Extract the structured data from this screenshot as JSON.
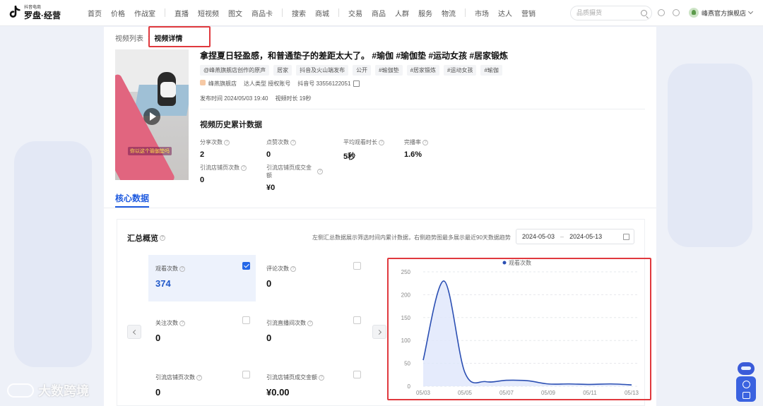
{
  "app": {
    "logo_small": "抖音电商",
    "logo_big": "罗盘·经营"
  },
  "nav": {
    "group1": [
      "首页",
      "价格",
      "作战室"
    ],
    "group2": [
      "直播",
      "短视频",
      "图文",
      "商品卡"
    ],
    "group3": [
      "搜索",
      "商城"
    ],
    "group4": [
      "交易",
      "商品",
      "人群",
      "服务",
      "物流"
    ],
    "group5": [
      "市场",
      "达人",
      "营销"
    ],
    "search_placeholder": "品质摄货",
    "shop_name": "峰燕官方旗舰店"
  },
  "breadcrumb": {
    "parent": "视频列表",
    "current": "视频详情"
  },
  "video": {
    "thumb_caption": "你以这个瑜伽垫吗",
    "title": "拿捏夏日轻盈感，和普通垫子的差距太大了。 #瑜伽 #瑜伽垫 #运动女孩 #居家锻炼",
    "tags": [
      "@峰燕旗舰店创作的原声",
      "居家",
      "抖音及火山端发布",
      "公开",
      "#瑜伽垫",
      "#居家锻炼",
      "#运动女孩",
      "#瑜伽"
    ],
    "author": "峰燕旗舰店",
    "talent_type": "达人类型 授权账号",
    "douyin_id": "抖音号 33556122051",
    "publish_time": "发布时间 2024/05/03 19:40",
    "duration": "视频时长 19秒"
  },
  "history": {
    "title": "视频历史累计数据",
    "stats": [
      {
        "label": "分享次数",
        "value": "2"
      },
      {
        "label": "点赞次数",
        "value": "0"
      },
      {
        "label": "平均观看时长",
        "value": "5秒"
      },
      {
        "label": "完播率",
        "value": "1.6%"
      },
      {
        "label": "引流店铺页次数",
        "value": "0"
      },
      {
        "label": "引流店铺页成交金额",
        "value": "¥0"
      }
    ]
  },
  "core_tab": "核心数据",
  "overview": {
    "title": "汇总概览",
    "note": "左侧汇总数据展示筛选时间内累计数据，右侧趋势图最多展示最近90天数据趋势",
    "date_start": "2024-05-03",
    "date_end": "2024-05-13",
    "metrics": [
      {
        "label": "观看次数",
        "value": "374",
        "selected": true
      },
      {
        "label": "评论次数",
        "value": "0",
        "selected": false
      },
      {
        "label": "关注次数",
        "value": "0",
        "selected": false
      },
      {
        "label": "引流直播间次数",
        "value": "0",
        "selected": false
      },
      {
        "label": "引流店铺页次数",
        "value": "0",
        "selected": false
      },
      {
        "label": "引流店铺页成交金额",
        "value": "¥0.00",
        "selected": false
      }
    ]
  },
  "chart_data": {
    "type": "area",
    "legend": "观看次数",
    "legend_position": "top-center",
    "x_ticks": [
      "05/03",
      "05/05",
      "05/07",
      "05/09",
      "05/11",
      "05/13"
    ],
    "y_ticks": [
      0,
      50,
      100,
      150,
      200,
      250
    ],
    "ylim": [
      0,
      250
    ],
    "x": [
      "05/03",
      "05/04",
      "05/05",
      "05/06",
      "05/07",
      "05/08",
      "05/09",
      "05/10",
      "05/11",
      "05/12",
      "05/13"
    ],
    "values": [
      57,
      230,
      30,
      10,
      13,
      12,
      5,
      5,
      4,
      5,
      3
    ],
    "grid": true,
    "color": "#2b4fb3",
    "fill": "#dfe6fb"
  },
  "watermark": "大数跨境"
}
